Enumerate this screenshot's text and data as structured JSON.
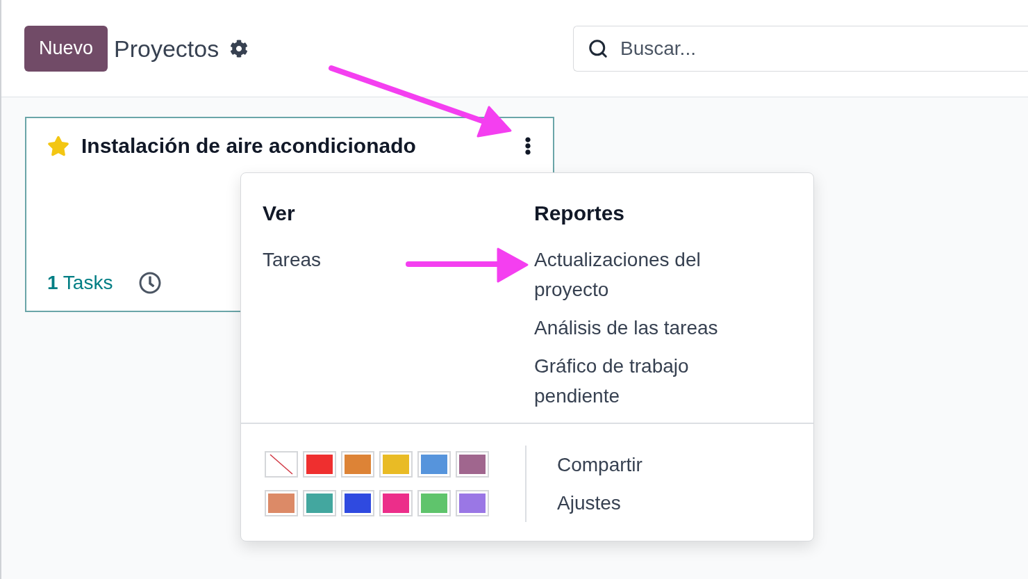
{
  "control_panel": {
    "new_button": "Nuevo",
    "breadcrumb": "Proyectos",
    "search": {
      "placeholder": "Buscar..."
    }
  },
  "project_card": {
    "favorite": true,
    "title": "Instalación de aire acondicionado",
    "tasks_link": "**1** Tasks"
  },
  "dropdown_menu": {
    "sections": [
      {
        "heading": "Ver",
        "items": [
          "Tareas"
        ]
      },
      {
        "heading": "Reportes",
        "items": [
          "Actualizaciones del proyecto",
          "Análisis de las tareas",
          "Gráfico de trabajo pendiente"
        ]
      }
    ],
    "colors": [
      {
        "kind": "none"
      },
      {
        "kind": "color",
        "color": "#ef2f2f"
      },
      {
        "kind": "color",
        "color": "#dd8336"
      },
      {
        "kind": "color",
        "color": "#e9bb25"
      },
      {
        "kind": "color",
        "color": "#5694dc"
      },
      {
        "kind": "color",
        "color": "#a0668e"
      },
      {
        "kind": "color",
        "color": "#dc8a67"
      },
      {
        "kind": "color",
        "color": "#43a79f"
      },
      {
        "kind": "color",
        "color": "#2f4ae0"
      },
      {
        "kind": "color",
        "color": "#ec2e8a"
      },
      {
        "kind": "color",
        "color": "#5fc46c"
      },
      {
        "kind": "color",
        "color": "#9a77e5"
      }
    ],
    "actions": [
      "Compartir",
      "Ajustes"
    ]
  }
}
